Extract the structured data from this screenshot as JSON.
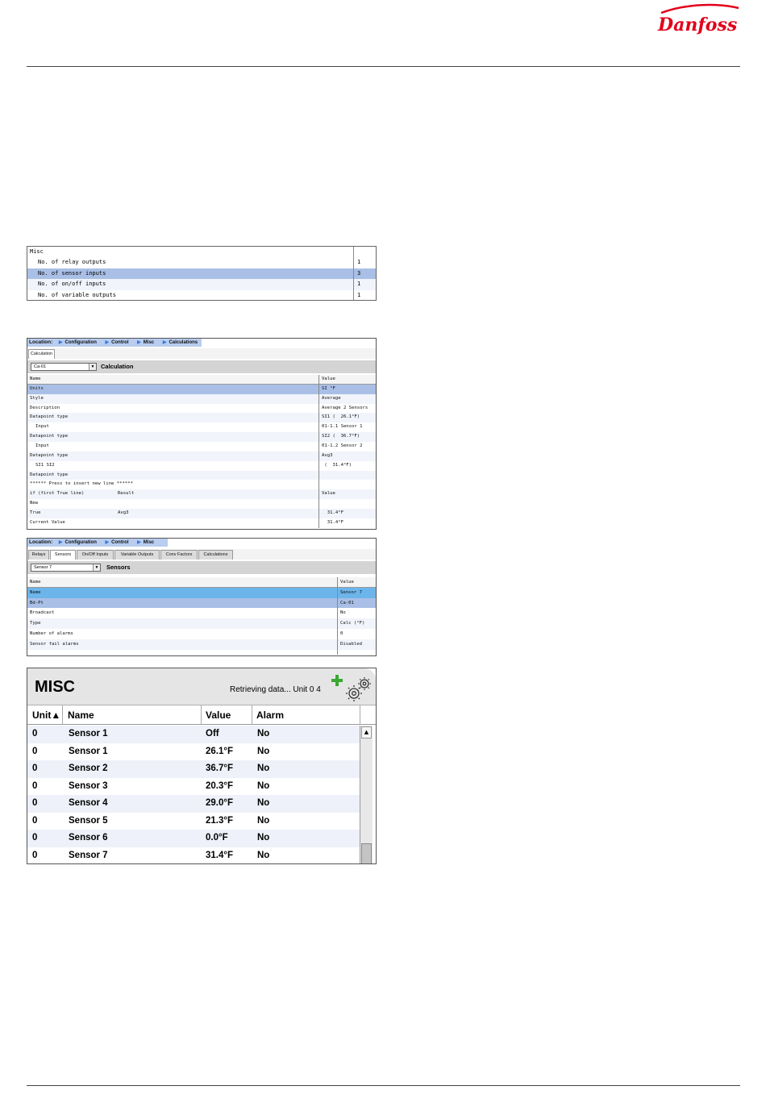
{
  "brand": {
    "name": "Danfoss",
    "color": "#e2001a"
  },
  "misc_table": {
    "rows": [
      {
        "name": "Misc",
        "value": ""
      },
      {
        "name": "No. of relay outputs",
        "value": "1"
      },
      {
        "name": "No. of sensor inputs",
        "value": "3",
        "selected": true
      },
      {
        "name": "No. of on/off inputs",
        "value": "1"
      },
      {
        "name": "No. of variable outputs",
        "value": "1"
      }
    ]
  },
  "calc_screen": {
    "location_label": "Location:",
    "crumbs": [
      "Configuration",
      "Control",
      "Misc",
      "Calculations"
    ],
    "tabs": [
      "Calculation"
    ],
    "dropdown_value": "Ca-01",
    "bar_title": "Calculation",
    "col_name": "Name",
    "col_value": "Value",
    "rows": [
      {
        "name": "Units",
        "mid": "",
        "value": "SI °F"
      },
      {
        "name": "Style",
        "mid": "",
        "value": "Average"
      },
      {
        "name": "Description",
        "mid": "",
        "value": "Average 2 Sensors"
      },
      {
        "name": "Datapoint type",
        "mid": "",
        "value": "SI1 (  26.1°F)"
      },
      {
        "name": "Input",
        "mid": "",
        "value": "01-1.1 Sensor 1"
      },
      {
        "name": "Datapoint type",
        "mid": "",
        "value": "SI2 (  36.7°F)"
      },
      {
        "name": "Input",
        "mid": "",
        "value": "01-1.2 Sensor 2"
      },
      {
        "name": "Datapoint type",
        "mid": "",
        "value": "Avg3"
      },
      {
        "name": "SI1 SI2",
        "mid": "",
        "value": " (  31.4°F)"
      },
      {
        "name": "Datapoint type",
        "mid": "",
        "value": ""
      },
      {
        "name": "****** Press to insert new line ******",
        "mid": "",
        "value": ""
      },
      {
        "name": "if (first True line)",
        "mid": "Result",
        "value": "Value"
      },
      {
        "name": "New",
        "mid": "",
        "value": ""
      },
      {
        "name": "True",
        "mid": "Avg3",
        "value": "  31.4°F"
      },
      {
        "name": "Current Value",
        "mid": "",
        "value": "  31.4°F"
      }
    ]
  },
  "sensor_screen": {
    "location_label": "Location:",
    "crumbs": [
      "Configuration",
      "Control",
      "Misc"
    ],
    "tabs": [
      "Relays",
      "Sensors",
      "On/Off Inputs",
      "Variable Outputs",
      "Conv Factors",
      "Calculations"
    ],
    "active_tab": "Sensors",
    "dropdown_value": "Sensor 7",
    "bar_title": "Sensors",
    "col_name": "Name",
    "col_value": "Value",
    "rows": [
      {
        "name": "Name",
        "value": "Sensor 7"
      },
      {
        "name": "Bd-Pt",
        "value": "Ca-01"
      },
      {
        "name": "Broadcast",
        "value": "No"
      },
      {
        "name": "Type",
        "value": "Calc (°F)"
      },
      {
        "name": "Number of alarms",
        "value": "0"
      },
      {
        "name": "Sensor fail alarms",
        "value": "Disabled"
      }
    ]
  },
  "misc_widget": {
    "title": "MISC",
    "status": "Retrieving data... Unit 0 4",
    "columns": [
      "Unit▲",
      "Name",
      "Value",
      "Alarm"
    ],
    "rows": [
      {
        "unit": "0",
        "name": "Sensor 1",
        "value": "Off",
        "alarm": "No"
      },
      {
        "unit": "0",
        "name": "Sensor 1",
        "value": "26.1°F",
        "alarm": "No"
      },
      {
        "unit": "0",
        "name": "Sensor 2",
        "value": "36.7°F",
        "alarm": "No"
      },
      {
        "unit": "0",
        "name": "Sensor 3",
        "value": "20.3°F",
        "alarm": "No"
      },
      {
        "unit": "0",
        "name": "Sensor 4",
        "value": "29.0°F",
        "alarm": "No"
      },
      {
        "unit": "0",
        "name": "Sensor 5",
        "value": "21.3°F",
        "alarm": "No"
      },
      {
        "unit": "0",
        "name": "Sensor 6",
        "value": "0.0°F",
        "alarm": "No"
      },
      {
        "unit": "0",
        "name": "Sensor 7",
        "value": "31.4°F",
        "alarm": "No"
      }
    ],
    "scroll_up_glyph": "▲",
    "dropdown_glyph": "▼"
  }
}
